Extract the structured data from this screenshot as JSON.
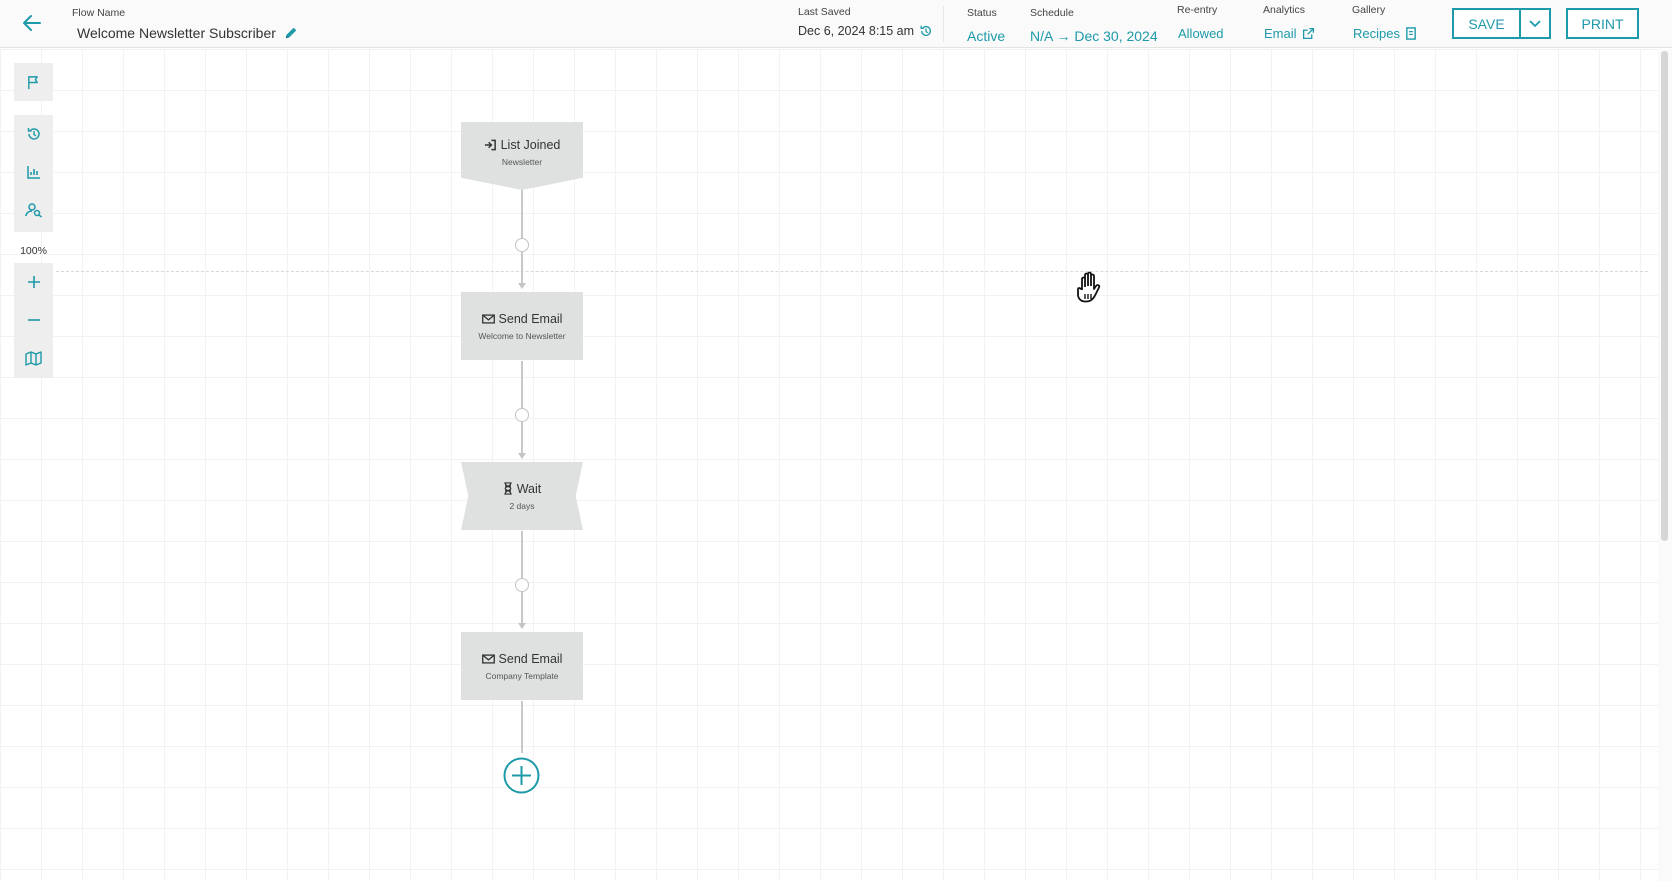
{
  "header": {
    "flow_name_label": "Flow Name",
    "flow_name": "Welcome Newsletter Subscriber",
    "last_saved_label": "Last Saved",
    "last_saved": "Dec 6, 2024 8:15 am",
    "status_label": "Status",
    "status": "Active",
    "schedule_label": "Schedule",
    "schedule": "N/A → Dec 30, 2024",
    "reentry_label": "Re-entry",
    "reentry": "Allowed",
    "analytics_label": "Analytics",
    "analytics": "Email",
    "gallery_label": "Gallery",
    "gallery": "Recipes",
    "save_label": "SAVE",
    "print_label": "PRINT"
  },
  "toolbar": {
    "zoom": "100%",
    "icons": [
      "flag-icon",
      "history-icon",
      "chart-icon",
      "audience-icon",
      "plus-icon",
      "minus-icon",
      "map-icon"
    ]
  },
  "flow": {
    "nodes": [
      {
        "title": "List Joined",
        "subtitle": "Newsletter",
        "icon": "sign-in-icon",
        "kind": "trigger"
      },
      {
        "title": "Send Email",
        "subtitle": "Welcome to Newsletter",
        "icon": "envelope-icon",
        "kind": "email"
      },
      {
        "title": "Wait",
        "subtitle": "2 days",
        "icon": "hourglass-icon",
        "kind": "wait"
      },
      {
        "title": "Send Email",
        "subtitle": "Company Template",
        "icon": "envelope-icon",
        "kind": "email"
      }
    ]
  },
  "colors": {
    "accent": "#1d9aa9",
    "node": "#dfe1e1",
    "connector": "#c4c4c4"
  }
}
